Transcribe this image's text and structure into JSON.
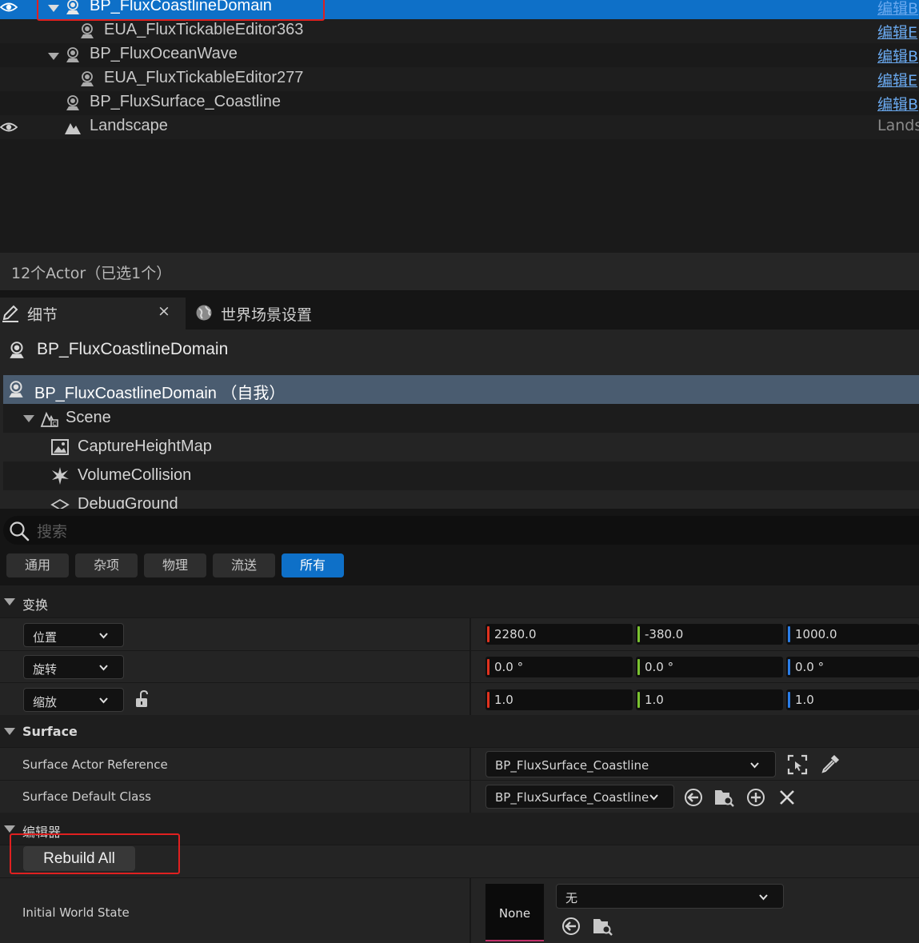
{
  "outliner": {
    "rows": [
      {
        "label": "BP_FluxCoastlineDomain",
        "type": "编辑B"
      },
      {
        "label": "EUA_FluxTickableEditor363",
        "type": "编辑E"
      },
      {
        "label": "BP_FluxOceanWave",
        "type": "编辑B"
      },
      {
        "label": "EUA_FluxTickableEditor277",
        "type": "编辑E"
      },
      {
        "label": "BP_FluxSurface_Coastline",
        "type": "编辑B"
      },
      {
        "label": "Landscape",
        "type": "Lands"
      }
    ],
    "status": "12个Actor（已选1个）"
  },
  "tabs": {
    "details": "细节",
    "close": "×",
    "world": "世界场景设置"
  },
  "details": {
    "actor_name": "BP_FluxCoastlineDomain",
    "components": [
      {
        "label": "BP_FluxCoastlineDomain （自我）"
      },
      {
        "label": "Scene"
      },
      {
        "label": "CaptureHeightMap"
      },
      {
        "label": "VolumeCollision"
      },
      {
        "label": "DebugGround"
      }
    ],
    "search_placeholder": "搜索",
    "filters": [
      "通用",
      "杂项",
      "物理",
      "流送",
      "所有"
    ],
    "transform": {
      "title": "变换",
      "location": {
        "label": "位置",
        "x": "2280.0",
        "y": "-380.0",
        "z": "1000.0"
      },
      "rotation": {
        "label": "旋转",
        "x": "0.0 °",
        "y": "0.0 °",
        "z": "0.0 °"
      },
      "scale": {
        "label": "缩放",
        "x": "1.0",
        "y": "1.0",
        "z": "1.0"
      }
    },
    "surface": {
      "title": "Surface",
      "actor_ref_label": "Surface Actor Reference",
      "actor_ref_value": "BP_FluxSurface_Coastline",
      "default_class_label": "Surface Default Class",
      "default_class_value": "BP_FluxSurface_Coastline"
    },
    "editor": {
      "title": "编辑器",
      "rebuild_label": "Rebuild All"
    },
    "world_state": {
      "label": "Initial World State",
      "thumb": "None",
      "value": "无"
    }
  },
  "colors": {
    "selection": "#0e70c8",
    "axis_x": "#e0321e",
    "axis_y": "#7ac230",
    "axis_z": "#2a7ee8",
    "highlight": "#e02020"
  }
}
